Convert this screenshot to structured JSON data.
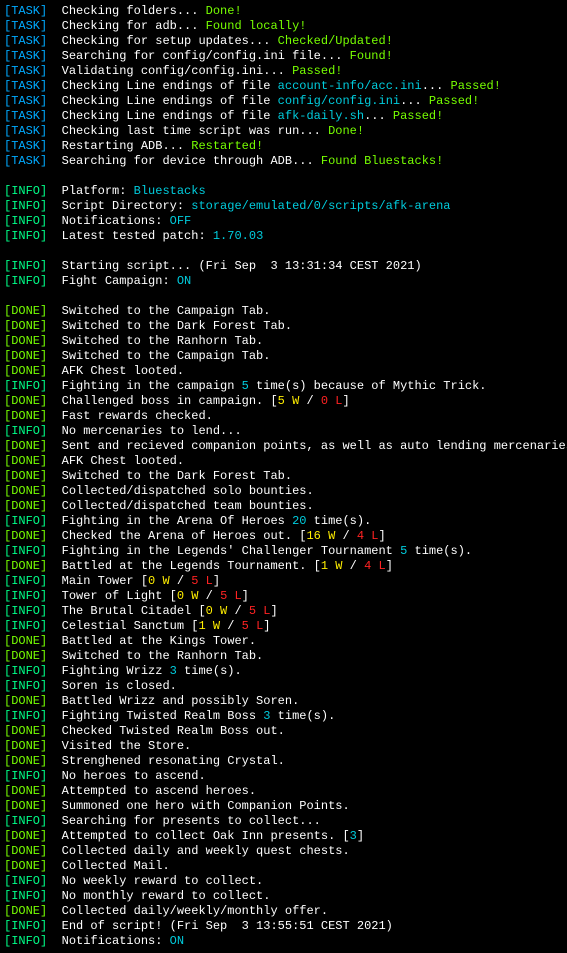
{
  "lines": [
    {
      "tag": "TASK",
      "parts": [
        {
          "c": "white",
          "t": "Checking folders... "
        },
        {
          "c": "green",
          "t": "Done!"
        }
      ]
    },
    {
      "tag": "TASK",
      "parts": [
        {
          "c": "white",
          "t": "Checking for adb... "
        },
        {
          "c": "green",
          "t": "Found locally!"
        }
      ]
    },
    {
      "tag": "TASK",
      "parts": [
        {
          "c": "white",
          "t": "Checking for setup updates... "
        },
        {
          "c": "green",
          "t": "Checked/Updated!"
        }
      ]
    },
    {
      "tag": "TASK",
      "parts": [
        {
          "c": "white",
          "t": "Searching for config/config.ini file... "
        },
        {
          "c": "green",
          "t": "Found!"
        }
      ]
    },
    {
      "tag": "TASK",
      "parts": [
        {
          "c": "white",
          "t": "Validating config/config.ini... "
        },
        {
          "c": "green",
          "t": "Passed!"
        }
      ]
    },
    {
      "tag": "TASK",
      "parts": [
        {
          "c": "white",
          "t": "Checking Line endings of file "
        },
        {
          "c": "cyan",
          "t": "account-info/acc.ini"
        },
        {
          "c": "white",
          "t": "... "
        },
        {
          "c": "green",
          "t": "Passed!"
        }
      ]
    },
    {
      "tag": "TASK",
      "parts": [
        {
          "c": "white",
          "t": "Checking Line endings of file "
        },
        {
          "c": "cyan",
          "t": "config/config.ini"
        },
        {
          "c": "white",
          "t": "... "
        },
        {
          "c": "green",
          "t": "Passed!"
        }
      ]
    },
    {
      "tag": "TASK",
      "parts": [
        {
          "c": "white",
          "t": "Checking Line endings of file "
        },
        {
          "c": "cyan",
          "t": "afk-daily.sh"
        },
        {
          "c": "white",
          "t": "... "
        },
        {
          "c": "green",
          "t": "Passed!"
        }
      ]
    },
    {
      "tag": "TASK",
      "parts": [
        {
          "c": "white",
          "t": "Checking last time script was run... "
        },
        {
          "c": "green",
          "t": "Done!"
        }
      ]
    },
    {
      "tag": "TASK",
      "parts": [
        {
          "c": "white",
          "t": "Restarting ADB... "
        },
        {
          "c": "green",
          "t": "Restarted!"
        }
      ]
    },
    {
      "tag": "TASK",
      "parts": [
        {
          "c": "white",
          "t": "Searching for device through ADB... "
        },
        {
          "c": "green",
          "t": "Found Bluestacks!"
        }
      ]
    },
    {
      "blank": true
    },
    {
      "tag": "INFO",
      "parts": [
        {
          "c": "white",
          "t": "Platform: "
        },
        {
          "c": "cyan",
          "t": "Bluestacks"
        }
      ]
    },
    {
      "tag": "INFO",
      "parts": [
        {
          "c": "white",
          "t": "Script Directory: "
        },
        {
          "c": "cyan",
          "t": "storage/emulated/0/scripts/afk-arena"
        }
      ]
    },
    {
      "tag": "INFO",
      "parts": [
        {
          "c": "white",
          "t": "Notifications: "
        },
        {
          "c": "cyan",
          "t": "OFF"
        }
      ]
    },
    {
      "tag": "INFO",
      "parts": [
        {
          "c": "white",
          "t": "Latest tested patch: "
        },
        {
          "c": "cyan",
          "t": "1.70.03"
        }
      ]
    },
    {
      "blank": true
    },
    {
      "tag": "INFO",
      "parts": [
        {
          "c": "white",
          "t": "Starting script... (Fri Sep  3 13:31:34 CEST 2021)"
        }
      ]
    },
    {
      "tag": "INFO",
      "parts": [
        {
          "c": "white",
          "t": "Fight Campaign: "
        },
        {
          "c": "cyan",
          "t": "ON"
        }
      ]
    },
    {
      "blank": true
    },
    {
      "tag": "DONE",
      "parts": [
        {
          "c": "white",
          "t": "Switched to the Campaign Tab."
        }
      ]
    },
    {
      "tag": "DONE",
      "parts": [
        {
          "c": "white",
          "t": "Switched to the Dark Forest Tab."
        }
      ]
    },
    {
      "tag": "DONE",
      "parts": [
        {
          "c": "white",
          "t": "Switched to the Ranhorn Tab."
        }
      ]
    },
    {
      "tag": "DONE",
      "parts": [
        {
          "c": "white",
          "t": "Switched to the Campaign Tab."
        }
      ]
    },
    {
      "tag": "DONE",
      "parts": [
        {
          "c": "white",
          "t": "AFK Chest looted."
        }
      ]
    },
    {
      "tag": "INFO",
      "parts": [
        {
          "c": "white",
          "t": "Fighting in the campaign "
        },
        {
          "c": "cyan",
          "t": "5"
        },
        {
          "c": "white",
          "t": " time(s) because of Mythic Trick."
        }
      ]
    },
    {
      "tag": "DONE",
      "parts": [
        {
          "c": "white",
          "t": "Challenged boss in campaign. ["
        },
        {
          "c": "yellow",
          "t": "5 W"
        },
        {
          "c": "white",
          "t": " / "
        },
        {
          "c": "red",
          "t": "0 L"
        },
        {
          "c": "white",
          "t": "]"
        }
      ]
    },
    {
      "tag": "DONE",
      "parts": [
        {
          "c": "white",
          "t": "Fast rewards checked."
        }
      ]
    },
    {
      "tag": "INFO",
      "parts": [
        {
          "c": "white",
          "t": "No mercenaries to lend..."
        }
      ]
    },
    {
      "tag": "DONE",
      "parts": [
        {
          "c": "white",
          "t": "Sent and recieved companion points, as well as auto lending mercenaries."
        }
      ]
    },
    {
      "tag": "DONE",
      "parts": [
        {
          "c": "white",
          "t": "AFK Chest looted."
        }
      ]
    },
    {
      "tag": "DONE",
      "parts": [
        {
          "c": "white",
          "t": "Switched to the Dark Forest Tab."
        }
      ]
    },
    {
      "tag": "DONE",
      "parts": [
        {
          "c": "white",
          "t": "Collected/dispatched solo bounties."
        }
      ]
    },
    {
      "tag": "DONE",
      "parts": [
        {
          "c": "white",
          "t": "Collected/dispatched team bounties."
        }
      ]
    },
    {
      "tag": "INFO",
      "parts": [
        {
          "c": "white",
          "t": "Fighting in the Arena Of Heroes "
        },
        {
          "c": "cyan",
          "t": "20"
        },
        {
          "c": "white",
          "t": " time(s)."
        }
      ]
    },
    {
      "tag": "DONE",
      "parts": [
        {
          "c": "white",
          "t": "Checked the Arena of Heroes out. ["
        },
        {
          "c": "yellow",
          "t": "16 W"
        },
        {
          "c": "white",
          "t": " / "
        },
        {
          "c": "red",
          "t": "4 L"
        },
        {
          "c": "white",
          "t": "]"
        }
      ]
    },
    {
      "tag": "INFO",
      "parts": [
        {
          "c": "white",
          "t": "Fighting in the Legends' Challenger Tournament "
        },
        {
          "c": "cyan",
          "t": "5"
        },
        {
          "c": "white",
          "t": " time(s)."
        }
      ]
    },
    {
      "tag": "DONE",
      "parts": [
        {
          "c": "white",
          "t": "Battled at the Legends Tournament. ["
        },
        {
          "c": "yellow",
          "t": "1 W"
        },
        {
          "c": "white",
          "t": " / "
        },
        {
          "c": "red",
          "t": "4 L"
        },
        {
          "c": "white",
          "t": "]"
        }
      ]
    },
    {
      "tag": "INFO",
      "parts": [
        {
          "c": "white",
          "t": "Main Tower ["
        },
        {
          "c": "yellow",
          "t": "0 W"
        },
        {
          "c": "white",
          "t": " / "
        },
        {
          "c": "red",
          "t": "5 L"
        },
        {
          "c": "white",
          "t": "]"
        }
      ]
    },
    {
      "tag": "INFO",
      "parts": [
        {
          "c": "white",
          "t": "Tower of Light ["
        },
        {
          "c": "yellow",
          "t": "0 W"
        },
        {
          "c": "white",
          "t": " / "
        },
        {
          "c": "red",
          "t": "5 L"
        },
        {
          "c": "white",
          "t": "]"
        }
      ]
    },
    {
      "tag": "INFO",
      "parts": [
        {
          "c": "white",
          "t": "The Brutal Citadel ["
        },
        {
          "c": "yellow",
          "t": "0 W"
        },
        {
          "c": "white",
          "t": " / "
        },
        {
          "c": "red",
          "t": "5 L"
        },
        {
          "c": "white",
          "t": "]"
        }
      ]
    },
    {
      "tag": "INFO",
      "parts": [
        {
          "c": "white",
          "t": "Celestial Sanctum ["
        },
        {
          "c": "yellow",
          "t": "1 W"
        },
        {
          "c": "white",
          "t": " / "
        },
        {
          "c": "red",
          "t": "5 L"
        },
        {
          "c": "white",
          "t": "]"
        }
      ]
    },
    {
      "tag": "DONE",
      "parts": [
        {
          "c": "white",
          "t": "Battled at the Kings Tower."
        }
      ]
    },
    {
      "tag": "DONE",
      "parts": [
        {
          "c": "white",
          "t": "Switched to the Ranhorn Tab."
        }
      ]
    },
    {
      "tag": "INFO",
      "parts": [
        {
          "c": "white",
          "t": "Fighting Wrizz "
        },
        {
          "c": "cyan",
          "t": "3"
        },
        {
          "c": "white",
          "t": " time(s)."
        }
      ]
    },
    {
      "tag": "INFO",
      "parts": [
        {
          "c": "white",
          "t": "Soren is closed."
        }
      ]
    },
    {
      "tag": "DONE",
      "parts": [
        {
          "c": "white",
          "t": "Battled Wrizz and possibly Soren."
        }
      ]
    },
    {
      "tag": "INFO",
      "parts": [
        {
          "c": "white",
          "t": "Fighting Twisted Realm Boss "
        },
        {
          "c": "cyan",
          "t": "3"
        },
        {
          "c": "white",
          "t": " time(s)."
        }
      ]
    },
    {
      "tag": "DONE",
      "parts": [
        {
          "c": "white",
          "t": "Checked Twisted Realm Boss out."
        }
      ]
    },
    {
      "tag": "DONE",
      "parts": [
        {
          "c": "white",
          "t": "Visited the Store."
        }
      ]
    },
    {
      "tag": "DONE",
      "parts": [
        {
          "c": "white",
          "t": "Strenghened resonating Crystal."
        }
      ]
    },
    {
      "tag": "INFO",
      "parts": [
        {
          "c": "white",
          "t": "No heroes to ascend."
        }
      ]
    },
    {
      "tag": "DONE",
      "parts": [
        {
          "c": "white",
          "t": "Attempted to ascend heroes."
        }
      ]
    },
    {
      "tag": "DONE",
      "parts": [
        {
          "c": "white",
          "t": "Summoned one hero with Companion Points."
        }
      ]
    },
    {
      "tag": "INFO",
      "parts": [
        {
          "c": "white",
          "t": "Searching for presents to collect..."
        }
      ]
    },
    {
      "tag": "DONE",
      "parts": [
        {
          "c": "white",
          "t": "Attempted to collect Oak Inn presents. ["
        },
        {
          "c": "cyan",
          "t": "3"
        },
        {
          "c": "white",
          "t": "]"
        }
      ]
    },
    {
      "tag": "DONE",
      "parts": [
        {
          "c": "white",
          "t": "Collected daily and weekly quest chests."
        }
      ]
    },
    {
      "tag": "DONE",
      "parts": [
        {
          "c": "white",
          "t": "Collected Mail."
        }
      ]
    },
    {
      "tag": "INFO",
      "parts": [
        {
          "c": "white",
          "t": "No weekly reward to collect."
        }
      ]
    },
    {
      "tag": "INFO",
      "parts": [
        {
          "c": "white",
          "t": "No monthly reward to collect."
        }
      ]
    },
    {
      "tag": "DONE",
      "parts": [
        {
          "c": "white",
          "t": "Collected daily/weekly/monthly offer."
        }
      ]
    },
    {
      "tag": "INFO",
      "parts": [
        {
          "c": "white",
          "t": "End of script! (Fri Sep  3 13:55:51 CEST 2021)"
        }
      ]
    },
    {
      "tag": "INFO",
      "parts": [
        {
          "c": "white",
          "t": "Notifications: "
        },
        {
          "c": "cyan",
          "t": "ON"
        }
      ]
    }
  ]
}
